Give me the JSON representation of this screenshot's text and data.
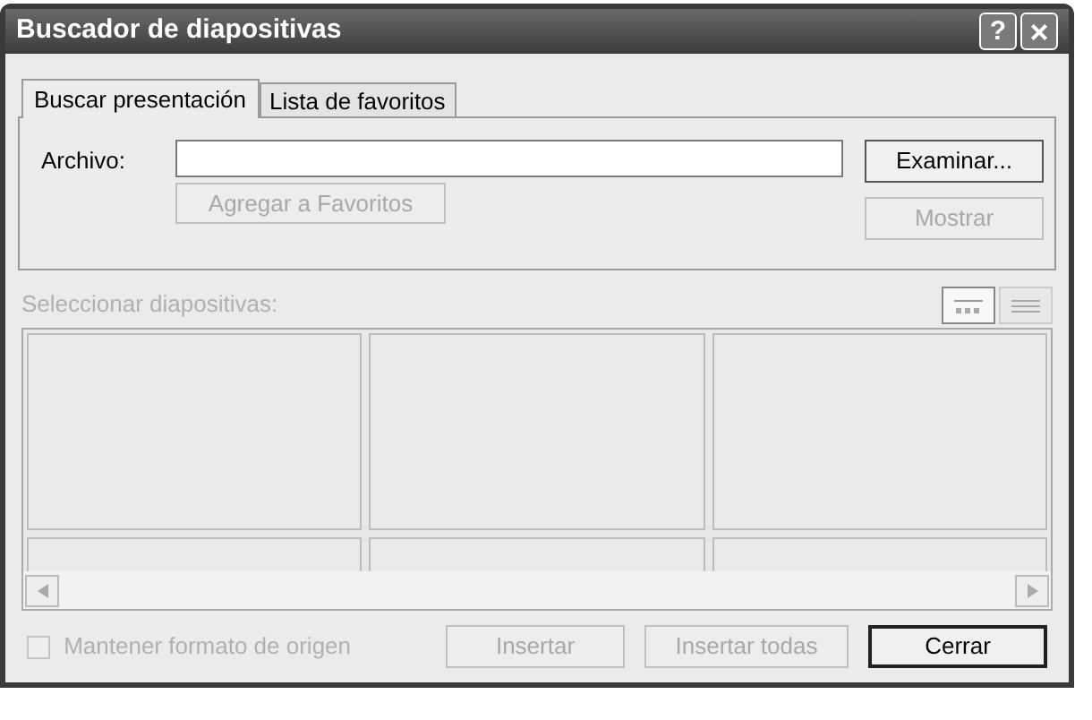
{
  "window": {
    "title": "Buscador de diapositivas",
    "help_button": "?",
    "close_button": "×"
  },
  "tabs": [
    {
      "label": "Buscar presentación",
      "selected": true
    },
    {
      "label": "Lista de favoritos",
      "selected": false
    }
  ],
  "file": {
    "label": "Archivo:"
  },
  "browse_button": {
    "label": "Examinar...",
    "disabled": false
  },
  "add_favorites_button": {
    "label": "Agregar a Favoritos",
    "disabled": true
  },
  "show_button": {
    "label": "Mostrar",
    "disabled": true
  },
  "slides_label": {
    "text": "Seleccionar diapositivas:",
    "disabled": true
  },
  "view_buttons": [
    {
      "selected": true
    },
    {
      "selected": false
    }
  ],
  "keep_format": {
    "label": "Mantener formato de origen",
    "checked": false,
    "disabled": true
  },
  "buttons": [
    {
      "label": "Insertar",
      "disabled": true,
      "default": false
    },
    {
      "label": "Insertar todas",
      "disabled": true,
      "default": false
    },
    {
      "label": "Cerrar",
      "disabled": false,
      "default": true
    }
  ]
}
